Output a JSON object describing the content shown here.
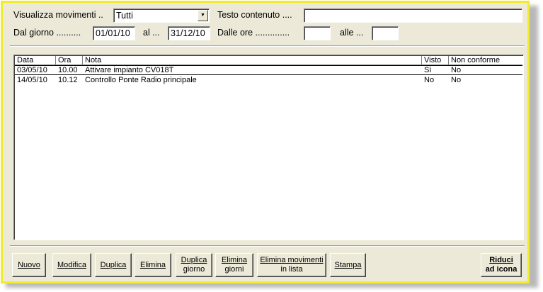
{
  "filters": {
    "movimenti_label": "Visualizza movimenti ..",
    "movimenti_value": "Tutti",
    "testo_label": "Testo contenuto ....",
    "testo_value": "",
    "dal_giorno_label": "Dal giorno ..........",
    "dal_giorno_value": "01/01/10",
    "al_label": "al ...",
    "al_value": "31/12/10",
    "dalle_ore_label": "Dalle ore ..............",
    "dalle_ore_value": "",
    "alle_label": "alle ...",
    "alle_value": ""
  },
  "list": {
    "columns": [
      "Data",
      "Ora",
      "Nota",
      "Visto",
      "Non conforme"
    ],
    "rows": [
      {
        "data": "03/05/10",
        "ora": "10.00",
        "nota": "Attivare impianto CV018T",
        "visto": "Sì",
        "non_conforme": "No"
      },
      {
        "data": "14/05/10",
        "ora": "10.12",
        "nota": "Controllo Ponte Radio principale",
        "visto": "No",
        "non_conforme": "No"
      }
    ]
  },
  "buttons": {
    "nuovo": "Nuovo",
    "modifica": "Modifica",
    "duplica": "Duplica",
    "elimina": "Elimina",
    "duplica_giorno_1": "Duplica",
    "duplica_giorno_2": "giorno",
    "elimina_giorni_1": "Elimina",
    "elimina_giorni_2": "giorni",
    "elimina_movimenti_1": "Elimina movimenti",
    "elimina_movimenti_2": "in lista",
    "stampa": "Stampa",
    "riduci_1": "Riduci",
    "riduci_2": "ad icona"
  },
  "colors": {
    "window_bg": "#ECE9D8",
    "border_highlight": "#F2EC2B"
  }
}
